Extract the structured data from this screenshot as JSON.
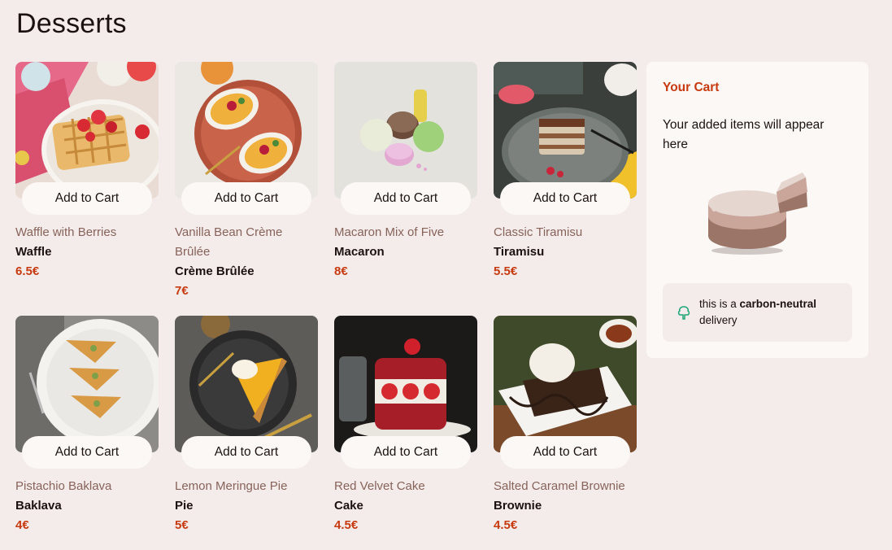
{
  "page": {
    "title": "Desserts"
  },
  "products": [
    {
      "subtitle": "Waffle with Berries",
      "name": "Waffle",
      "price": "6.5€",
      "button": "Add to Cart"
    },
    {
      "subtitle": "Vanilla Bean Crème Brûlée",
      "name": "Crème Brûlée",
      "price": "7€",
      "button": "Add to Cart"
    },
    {
      "subtitle": "Macaron Mix of Five",
      "name": "Macaron",
      "price": "8€",
      "button": "Add to Cart"
    },
    {
      "subtitle": "Classic Tiramisu",
      "name": "Tiramisu",
      "price": "5.5€",
      "button": "Add to Cart"
    },
    {
      "subtitle": "Pistachio Baklava",
      "name": "Baklava",
      "price": "4€",
      "button": "Add to Cart"
    },
    {
      "subtitle": "Lemon Meringue Pie",
      "name": "Pie",
      "price": "5€",
      "button": "Add to Cart"
    },
    {
      "subtitle": "Red Velvet Cake",
      "name": "Cake",
      "price": "4.5€",
      "button": "Add to Cart"
    },
    {
      "subtitle": "Salted Caramel Brownie",
      "name": "Brownie",
      "price": "4.5€",
      "button": "Add to Cart"
    }
  ],
  "cart": {
    "title": "Your Cart",
    "empty_message": "Your added items will appear here",
    "carbon_prefix": "this is a ",
    "carbon_bold": "carbon-neutral",
    "carbon_suffix": " delivery"
  },
  "colors": {
    "accent": "#c73a0f",
    "background": "#f4eceb",
    "panel": "#fcf8f6"
  },
  "icons": {
    "carbon_badge": "tree-icon",
    "cart_illustration": "empty-cart-cake-illustration"
  }
}
